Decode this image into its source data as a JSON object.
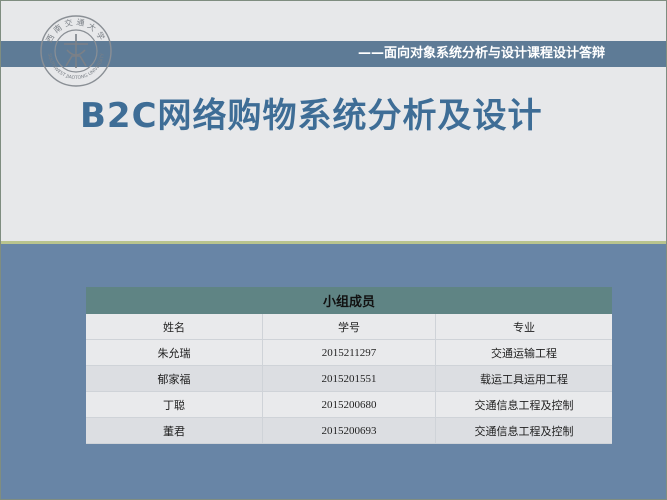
{
  "header": {
    "subtitle": "——面向对象系统分析与设计课程设计答辩",
    "title": "B2C网络购物系统分析及设计"
  },
  "logo": {
    "icon": "university-seal-icon",
    "top_text": "西南交通大学",
    "bottom_text": "SOUTHWEST JIAOTONG UNIVERSITY"
  },
  "members_table": {
    "caption": "小组成员",
    "columns": [
      "姓名",
      "学号",
      "专业"
    ],
    "rows": [
      [
        "朱允瑞",
        "2015211297",
        "交通运输工程"
      ],
      [
        "郁家福",
        "2015201551",
        "载运工具运用工程"
      ],
      [
        "丁聪",
        "2015200680",
        "交通信息工程及控制"
      ],
      [
        "董君",
        "2015200693",
        "交通信息工程及控制"
      ]
    ]
  },
  "colors": {
    "top_bar": "#5e7b96",
    "title": "#3e6d96",
    "lower_background": "#6885a6",
    "table_caption": "#5f8484",
    "divider": "#b9c48e"
  }
}
